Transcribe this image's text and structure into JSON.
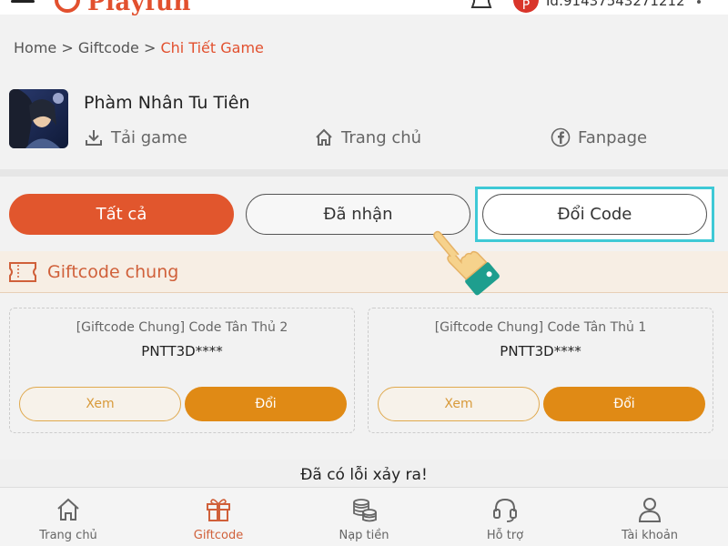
{
  "header": {
    "logo_text": "Playfun",
    "user_id": "Id:91437543271212"
  },
  "breadcrumb": {
    "home": "Home",
    "separator": " > ",
    "giftcode": "Giftcode",
    "current": "Chi Tiết Game"
  },
  "game": {
    "title": "Phàm Nhân Tu Tiên",
    "download_label": "Tải game",
    "homepage_label": "Trang chủ",
    "fanpage_label": "Fanpage"
  },
  "tabs": {
    "all": "Tất cả",
    "received": "Đã nhận",
    "redeem": "Đổi Code"
  },
  "section": {
    "title": "Giftcode chung"
  },
  "cards": [
    {
      "title": "[Giftcode Chung] Code Tân Thủ 2",
      "code": "PNTT3D****",
      "view_label": "Xem",
      "redeem_label": "Đổi"
    },
    {
      "title": "[Giftcode Chung] Code Tân Thủ 1",
      "code": "PNTT3D****",
      "view_label": "Xem",
      "redeem_label": "Đổi"
    }
  ],
  "error_message": "Đã có lỗi xảy ra!",
  "bottom_nav": [
    {
      "label": "Trang chủ",
      "icon": "home-icon"
    },
    {
      "label": "Giftcode",
      "icon": "gift-icon",
      "active": true
    },
    {
      "label": "Nạp tiền",
      "icon": "coins-icon"
    },
    {
      "label": "Hỗ trợ",
      "icon": "headset-icon"
    },
    {
      "label": "Tài khoản",
      "icon": "user-icon"
    }
  ],
  "colors": {
    "brand": "#e2502e",
    "accent_orange": "#e08a15",
    "highlight": "#3ec9d6"
  }
}
